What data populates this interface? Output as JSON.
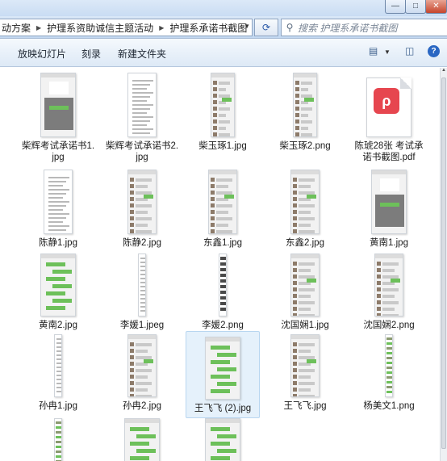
{
  "window": {
    "min_glyph": "—",
    "max_glyph": "□",
    "close_glyph": "✕"
  },
  "address": {
    "crumbs": [
      "动方案",
      "护理系资助诚信主题活动",
      "护理系承诺书截图"
    ],
    "refresh_glyph": "⟳",
    "search_placeholder": "搜索 护理系承诺书截图"
  },
  "toolbar": {
    "slideshow_label": "放映幻灯片",
    "burn_label": "刻录",
    "newfolder_label": "新建文件夹",
    "help_glyph": "?"
  },
  "files": [
    {
      "label": "柴辉考试承诺书1.jpg",
      "kind": "phone-photo",
      "selected": false
    },
    {
      "label": "柴辉考试承诺书2.jpg",
      "kind": "document",
      "selected": false
    },
    {
      "label": "柴玉琢1.jpg",
      "kind": "chat-tall",
      "selected": false
    },
    {
      "label": "柴玉琢2.png",
      "kind": "chat-tall",
      "selected": false
    },
    {
      "label": "陈琥28张 考试承诺书截图.pdf",
      "kind": "pdf",
      "selected": false
    },
    {
      "label": "陈静1.jpg",
      "kind": "document",
      "selected": false
    },
    {
      "label": "陈静2.jpg",
      "kind": "chat",
      "selected": false
    },
    {
      "label": "东鑫1.jpg",
      "kind": "chat",
      "selected": false
    },
    {
      "label": "东鑫2.jpg",
      "kind": "chat",
      "selected": false
    },
    {
      "label": "黄南1.jpg",
      "kind": "phone-photo",
      "selected": false
    },
    {
      "label": "黄南2.jpg",
      "kind": "green-chat",
      "selected": false
    },
    {
      "label": "李媛1.jpeg",
      "kind": "narrow",
      "selected": false
    },
    {
      "label": "李媛2.png",
      "kind": "narrow-dark",
      "selected": false
    },
    {
      "label": "沈国娴1.jpg",
      "kind": "chat",
      "selected": false
    },
    {
      "label": "沈国娴2.png",
      "kind": "chat",
      "selected": false
    },
    {
      "label": "孙冉1.jpg",
      "kind": "narrow",
      "selected": false
    },
    {
      "label": "孙冉2.jpg",
      "kind": "chat",
      "selected": false
    },
    {
      "label": "王飞飞 (2).jpg",
      "kind": "green-chat",
      "selected": true
    },
    {
      "label": "王飞飞.jpg",
      "kind": "chat",
      "selected": false
    },
    {
      "label": "杨美文1.png",
      "kind": "narrow-green",
      "selected": false
    },
    {
      "label": "",
      "kind": "narrow-green",
      "selected": false
    },
    {
      "label": "",
      "kind": "green-chat",
      "selected": false
    },
    {
      "label": "",
      "kind": "green-chat",
      "selected": false
    }
  ],
  "colors": {
    "selection": "#e5f1fb",
    "wechat_green": "#6dc05a",
    "pdf_red": "#e6464f"
  }
}
